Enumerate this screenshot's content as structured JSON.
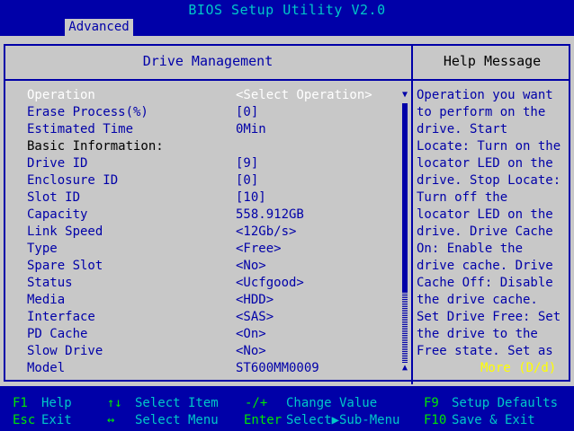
{
  "window": {
    "title": "BIOS Setup Utility V2.0"
  },
  "tab": {
    "label": "Advanced"
  },
  "panel": {
    "left_header": "Drive Management",
    "right_header": "Help Message"
  },
  "settings": [
    {
      "label": "Operation",
      "value": "<Select Operation>"
    },
    {
      "label": "Erase Process(%)",
      "value": "[0]"
    },
    {
      "label": "Estimated Time",
      "value": "0Min"
    },
    {
      "label": "Basic Information:",
      "value": ""
    },
    {
      "label": "Drive ID",
      "value": "[9]"
    },
    {
      "label": "Enclosure ID",
      "value": "[0]"
    },
    {
      "label": "Slot ID",
      "value": "[10]"
    },
    {
      "label": "Capacity",
      "value": "558.912GB"
    },
    {
      "label": "Link Speed",
      "value": "<12Gb/s>"
    },
    {
      "label": "Type",
      "value": "<Free>"
    },
    {
      "label": "Spare Slot",
      "value": "<No>"
    },
    {
      "label": "Status",
      "value": "<Ucfgood>"
    },
    {
      "label": "Media",
      "value": "<HDD>"
    },
    {
      "label": "Interface",
      "value": "<SAS>"
    },
    {
      "label": "PD Cache",
      "value": "<On>"
    },
    {
      "label": "Slow Drive",
      "value": "<No>"
    },
    {
      "label": "Model",
      "value": "ST600MM0009"
    }
  ],
  "help": {
    "lines": [
      "Operation you want",
      "to perform on the",
      "drive. Start",
      "Locate: Turn on the",
      "locator LED on the",
      "drive. Stop Locate:",
      "Turn off the",
      "locator LED on the",
      "drive. Drive Cache",
      "On: Enable the",
      "drive cache. Drive",
      "Cache Off: Disable",
      "the drive cache.",
      "Set Drive Free: Set",
      "the drive to the",
      "Free state. Set as"
    ],
    "more": "More (D/d)"
  },
  "footer": {
    "f1_key": "F1",
    "f1_desc": "Help",
    "esc_key": "Esc",
    "esc_desc": "Exit",
    "updown_key": "↑↓",
    "updown_desc": "Select Item",
    "leftright_key": "↔",
    "leftright_desc": "Select Menu",
    "change_key": "-/+",
    "change_desc": "Change Value",
    "enter_key": "Enter",
    "enter_desc": "Select▶Sub-Menu",
    "f9_key": "F9",
    "f9_desc": "Setup Defaults",
    "f10_key": "F10",
    "f10_desc": "Save & Exit"
  }
}
